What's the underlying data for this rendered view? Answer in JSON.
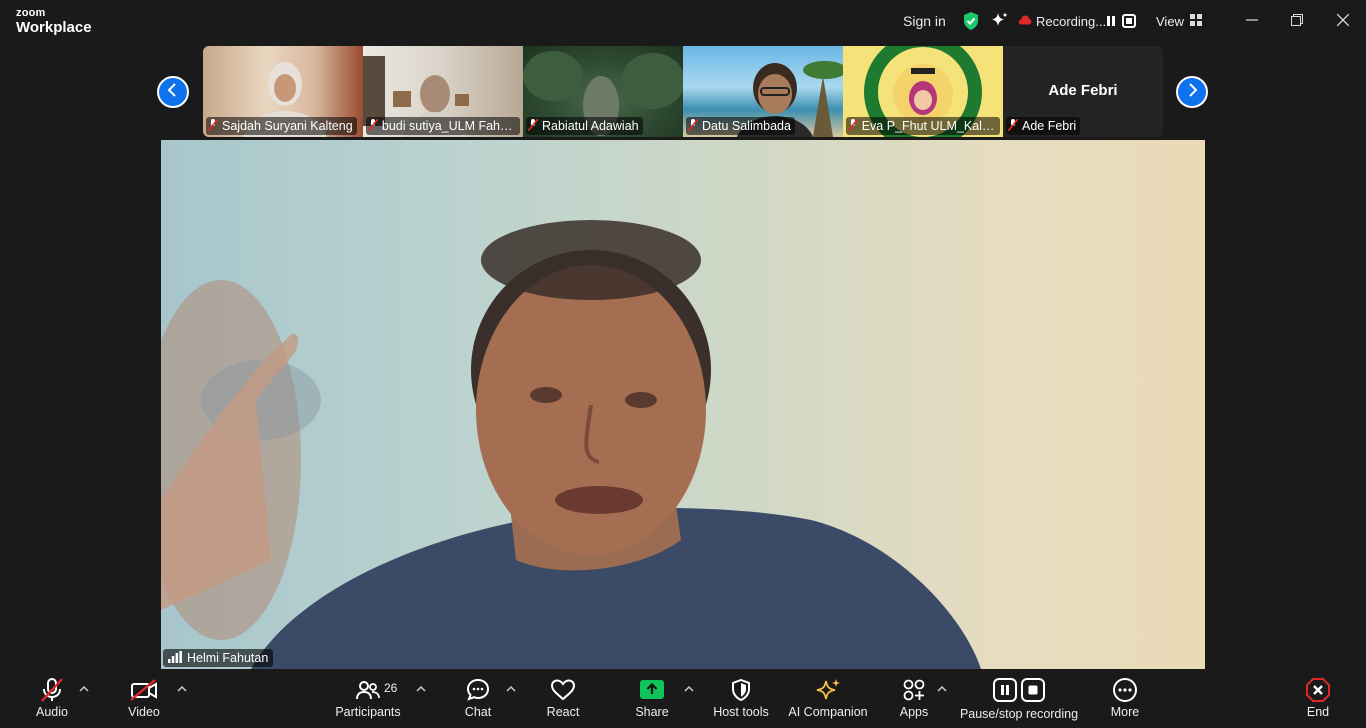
{
  "app": {
    "brand_small": "zoom",
    "brand_large": "Workplace"
  },
  "titlebar": {
    "sign_in": "Sign in",
    "recording_label": "Recording...",
    "view_label": "View",
    "icons": [
      "shield-check-icon",
      "sparkle-icon",
      "cloud-record-icon",
      "pause-icon",
      "stop-icon",
      "grid-icon",
      "minimize-icon",
      "restore-icon",
      "close-icon"
    ]
  },
  "gallery": {
    "participants": [
      {
        "name": "Sajdah Suryani Kalteng",
        "muted": true
      },
      {
        "name": "budi sutiya_ULM Fahu...",
        "muted": true
      },
      {
        "name": "Rabiatul Adawiah",
        "muted": true
      },
      {
        "name": "Datu Salimbada",
        "muted": true
      },
      {
        "name": "Eva P_Fhut ULM_KalSel",
        "muted": true
      },
      {
        "name": "Ade Febri",
        "muted": true,
        "video_off_label": "Ade Febri"
      }
    ]
  },
  "speaker": {
    "name": "Helmi Fahutan"
  },
  "toolbar": {
    "audio": "Audio",
    "video": "Video",
    "participants": "Participants",
    "participants_count": "26",
    "chat": "Chat",
    "react": "React",
    "share": "Share",
    "host_tools": "Host tools",
    "ai_companion": "AI Companion",
    "apps": "Apps",
    "pause_stop_recording": "Pause/stop recording",
    "more": "More",
    "end": "End"
  },
  "colors": {
    "accent": "#0e72ed",
    "share_green": "#0ec45a",
    "end_red": "#e02828",
    "muted_red": "#e02828",
    "ai_gold": "#f5c044",
    "shield_green": "#1ec96b"
  }
}
